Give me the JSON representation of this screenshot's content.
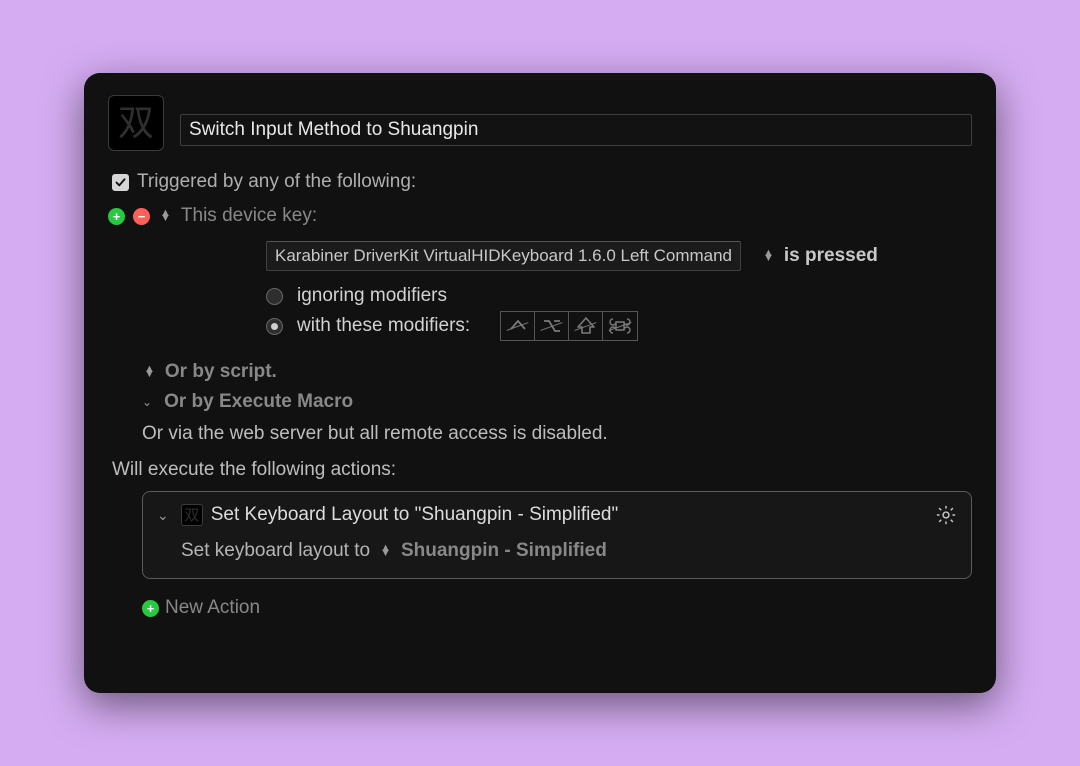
{
  "header": {
    "icon_glyph": "双",
    "title": "Switch Input Method to Shuangpin"
  },
  "trigger": {
    "header_label": "Triggered by any of the following:",
    "device_key_label": "This device key:",
    "device_value": "Karabiner DriverKit VirtualHIDKeyboard 1.6.0 Left Command",
    "pressed_label": "is pressed",
    "ignoring_label": "ignoring modifiers",
    "with_modifiers_label": "with these modifiers:",
    "selected_radio": "with_modifiers",
    "or_script_label": "Or by script.",
    "or_execute_label": "Or by Execute Macro",
    "web_text": "Or via the web server but all remote access is disabled."
  },
  "actions": {
    "header": "Will execute the following actions:",
    "items": [
      {
        "title": "Set Keyboard Layout to \"Shuangpin - Simplified\"",
        "sub_prefix": "Set keyboard layout to",
        "layout_name": "Shuangpin - Simplified",
        "icon_glyph": "双"
      }
    ],
    "new_action_label": "New Action"
  }
}
